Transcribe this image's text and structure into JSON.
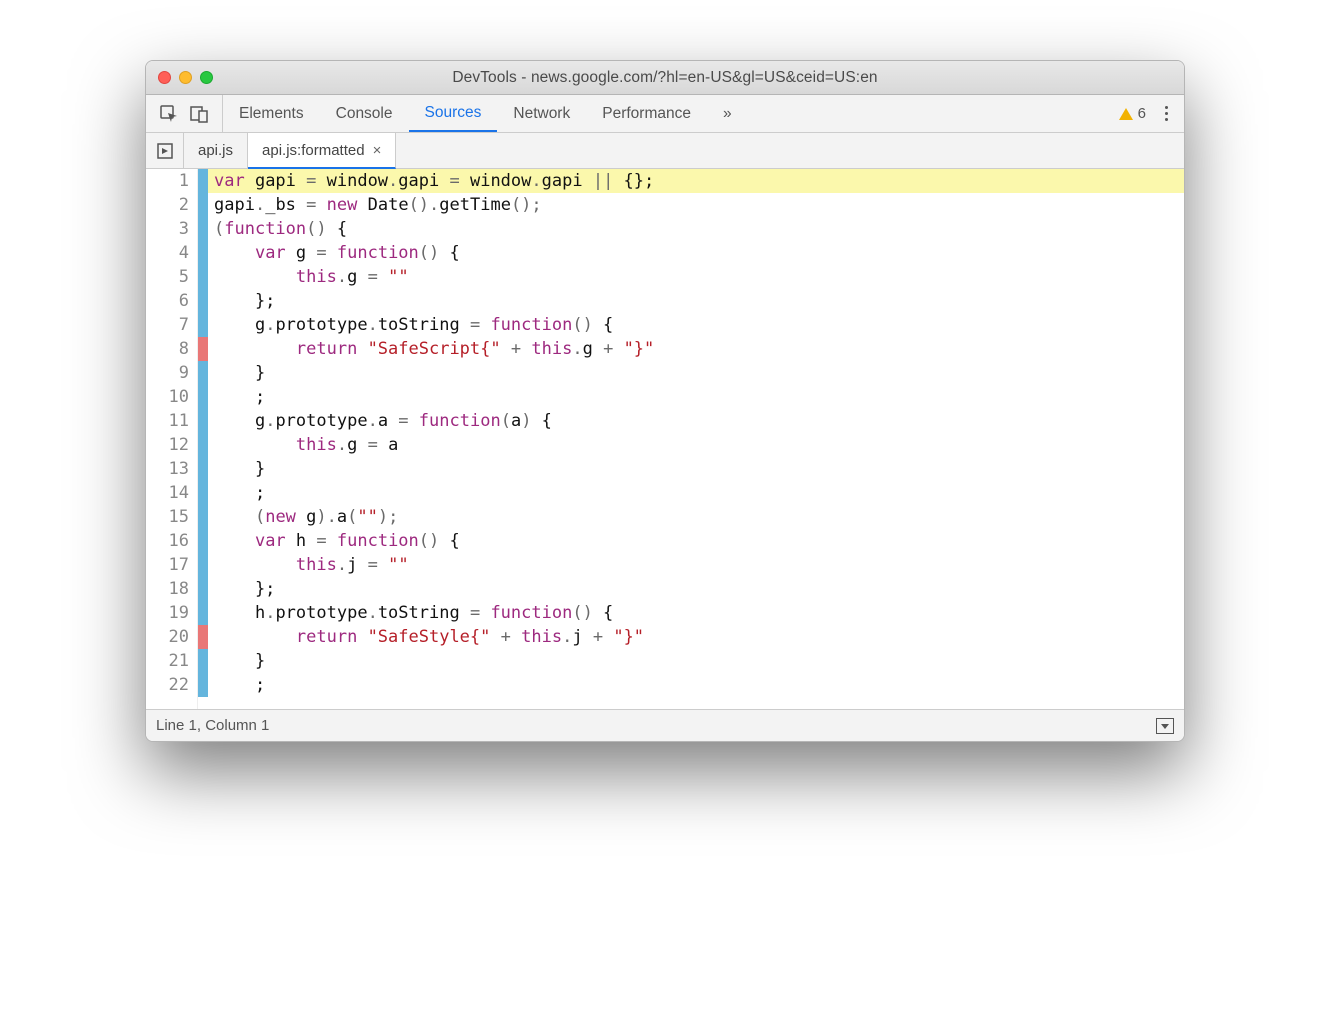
{
  "window": {
    "title": "DevTools - news.google.com/?hl=en-US&gl=US&ceid=US:en"
  },
  "maintabs": {
    "elements": "Elements",
    "console": "Console",
    "sources": "Sources",
    "network": "Network",
    "performance": "Performance"
  },
  "overflow_label": "»",
  "warning_count": "6",
  "filetabs": {
    "tab0": "api.js",
    "tab1": "api.js:formatted"
  },
  "code": {
    "lines": [
      {
        "n": "1",
        "fold": "blue",
        "hl": true,
        "tokens": [
          [
            "kw",
            "var"
          ],
          [
            "",
            " gapi "
          ],
          [
            "op",
            "="
          ],
          [
            "",
            " window"
          ],
          [
            "op",
            "."
          ],
          [
            "",
            "gapi "
          ],
          [
            "op",
            "="
          ],
          [
            "",
            " window"
          ],
          [
            "op",
            "."
          ],
          [
            "",
            "gapi "
          ],
          [
            "op",
            "||"
          ],
          [
            "",
            " {};"
          ]
        ]
      },
      {
        "n": "2",
        "fold": "blue",
        "tokens": [
          [
            "",
            "gapi"
          ],
          [
            "op",
            "."
          ],
          [
            "",
            "_bs "
          ],
          [
            "op",
            "="
          ],
          [
            "",
            " "
          ],
          [
            "kw",
            "new"
          ],
          [
            "",
            " Date"
          ],
          [
            "op",
            "()."
          ],
          [
            "",
            "getTime"
          ],
          [
            "op",
            "();"
          ]
        ]
      },
      {
        "n": "3",
        "fold": "blue",
        "tokens": [
          [
            "op",
            "("
          ],
          [
            "kw",
            "function"
          ],
          [
            "op",
            "()"
          ],
          [
            "",
            " {"
          ]
        ]
      },
      {
        "n": "4",
        "fold": "blue",
        "tokens": [
          [
            "",
            "    "
          ],
          [
            "kw",
            "var"
          ],
          [
            "",
            " g "
          ],
          [
            "op",
            "="
          ],
          [
            "",
            " "
          ],
          [
            "kw",
            "function"
          ],
          [
            "op",
            "()"
          ],
          [
            "",
            " {"
          ]
        ]
      },
      {
        "n": "5",
        "fold": "blue",
        "tokens": [
          [
            "",
            "        "
          ],
          [
            "kw",
            "this"
          ],
          [
            "op",
            "."
          ],
          [
            "",
            "g "
          ],
          [
            "op",
            "="
          ],
          [
            "",
            " "
          ],
          [
            "str",
            "\"\""
          ]
        ]
      },
      {
        "n": "6",
        "fold": "blue",
        "tokens": [
          [
            "",
            "    };"
          ]
        ]
      },
      {
        "n": "7",
        "fold": "blue",
        "tokens": [
          [
            "",
            "    g"
          ],
          [
            "op",
            "."
          ],
          [
            "",
            "prototype"
          ],
          [
            "op",
            "."
          ],
          [
            "",
            "toString "
          ],
          [
            "op",
            "="
          ],
          [
            "",
            " "
          ],
          [
            "kw",
            "function"
          ],
          [
            "op",
            "()"
          ],
          [
            "",
            " {"
          ]
        ]
      },
      {
        "n": "8",
        "fold": "redm",
        "tokens": [
          [
            "",
            "        "
          ],
          [
            "kw",
            "return"
          ],
          [
            "",
            " "
          ],
          [
            "str",
            "\"SafeScript{\""
          ],
          [
            "",
            " "
          ],
          [
            "op",
            "+"
          ],
          [
            "",
            " "
          ],
          [
            "kw",
            "this"
          ],
          [
            "op",
            "."
          ],
          [
            "",
            "g "
          ],
          [
            "op",
            "+"
          ],
          [
            "",
            " "
          ],
          [
            "str",
            "\"}\""
          ]
        ]
      },
      {
        "n": "9",
        "fold": "blue",
        "tokens": [
          [
            "",
            "    }"
          ]
        ]
      },
      {
        "n": "10",
        "fold": "blue",
        "tokens": [
          [
            "",
            "    ;"
          ]
        ]
      },
      {
        "n": "11",
        "fold": "blue",
        "tokens": [
          [
            "",
            "    g"
          ],
          [
            "op",
            "."
          ],
          [
            "",
            "prototype"
          ],
          [
            "op",
            "."
          ],
          [
            "",
            "a "
          ],
          [
            "op",
            "="
          ],
          [
            "",
            " "
          ],
          [
            "kw",
            "function"
          ],
          [
            "op",
            "("
          ],
          [
            "",
            "a"
          ],
          [
            "op",
            ")"
          ],
          [
            "",
            " {"
          ]
        ]
      },
      {
        "n": "12",
        "fold": "blue",
        "tokens": [
          [
            "",
            "        "
          ],
          [
            "kw",
            "this"
          ],
          [
            "op",
            "."
          ],
          [
            "",
            "g "
          ],
          [
            "op",
            "="
          ],
          [
            "",
            " a"
          ]
        ]
      },
      {
        "n": "13",
        "fold": "blue",
        "tokens": [
          [
            "",
            "    }"
          ]
        ]
      },
      {
        "n": "14",
        "fold": "blue",
        "tokens": [
          [
            "",
            "    ;"
          ]
        ]
      },
      {
        "n": "15",
        "fold": "blue",
        "tokens": [
          [
            "",
            "    "
          ],
          [
            "op",
            "("
          ],
          [
            "kw",
            "new"
          ],
          [
            "",
            " g"
          ],
          [
            "op",
            ")."
          ],
          [
            "",
            "a"
          ],
          [
            "op",
            "("
          ],
          [
            "str",
            "\"\""
          ],
          [
            "op",
            ");"
          ]
        ]
      },
      {
        "n": "16",
        "fold": "blue",
        "tokens": [
          [
            "",
            "    "
          ],
          [
            "kw",
            "var"
          ],
          [
            "",
            " h "
          ],
          [
            "op",
            "="
          ],
          [
            "",
            " "
          ],
          [
            "kw",
            "function"
          ],
          [
            "op",
            "()"
          ],
          [
            "",
            " {"
          ]
        ]
      },
      {
        "n": "17",
        "fold": "blue",
        "tokens": [
          [
            "",
            "        "
          ],
          [
            "kw",
            "this"
          ],
          [
            "op",
            "."
          ],
          [
            "",
            "j "
          ],
          [
            "op",
            "="
          ],
          [
            "",
            " "
          ],
          [
            "str",
            "\"\""
          ]
        ]
      },
      {
        "n": "18",
        "fold": "blue",
        "tokens": [
          [
            "",
            "    };"
          ]
        ]
      },
      {
        "n": "19",
        "fold": "blue",
        "tokens": [
          [
            "",
            "    h"
          ],
          [
            "op",
            "."
          ],
          [
            "",
            "prototype"
          ],
          [
            "op",
            "."
          ],
          [
            "",
            "toString "
          ],
          [
            "op",
            "="
          ],
          [
            "",
            " "
          ],
          [
            "kw",
            "function"
          ],
          [
            "op",
            "()"
          ],
          [
            "",
            " {"
          ]
        ]
      },
      {
        "n": "20",
        "fold": "redm",
        "tokens": [
          [
            "",
            "        "
          ],
          [
            "kw",
            "return"
          ],
          [
            "",
            " "
          ],
          [
            "str",
            "\"SafeStyle{\""
          ],
          [
            "",
            " "
          ],
          [
            "op",
            "+"
          ],
          [
            "",
            " "
          ],
          [
            "kw",
            "this"
          ],
          [
            "op",
            "."
          ],
          [
            "",
            "j "
          ],
          [
            "op",
            "+"
          ],
          [
            "",
            " "
          ],
          [
            "str",
            "\"}\""
          ]
        ]
      },
      {
        "n": "21",
        "fold": "blue",
        "tokens": [
          [
            "",
            "    }"
          ]
        ]
      },
      {
        "n": "22",
        "fold": "blue",
        "tokens": [
          [
            "",
            "    ;"
          ]
        ]
      }
    ]
  },
  "status": {
    "position": "Line 1, Column 1"
  }
}
